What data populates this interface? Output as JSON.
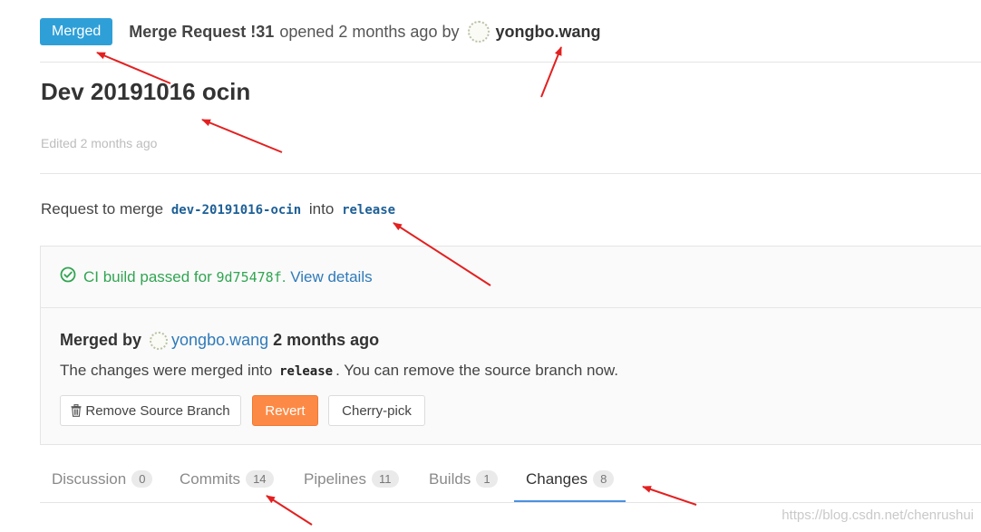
{
  "header": {
    "status_label": "Merged",
    "mr_id": "Merge Request !31",
    "opened_text": "opened 2 months ago by",
    "author": "yongbo.wang"
  },
  "title": "Dev 20191016 ocin",
  "edited": "Edited 2 months ago",
  "merge_request": {
    "prefix": "Request to merge",
    "source_branch": "dev-20191016-ocin",
    "into": "into",
    "target_branch": "release"
  },
  "ci": {
    "status_text": "CI build passed for",
    "sha": "9d75478f",
    "period": ".",
    "view_details": "View details"
  },
  "merged": {
    "label": "Merged by",
    "user": "yongbo.wang",
    "time": "2 months ago",
    "desc_before": "The changes were merged into",
    "branch": "release",
    "desc_after": ". You can remove the source branch now."
  },
  "buttons": {
    "remove_source_branch": "Remove Source Branch",
    "revert": "Revert",
    "cherry_pick": "Cherry-pick"
  },
  "tabs": [
    {
      "label": "Discussion",
      "count": "0"
    },
    {
      "label": "Commits",
      "count": "14"
    },
    {
      "label": "Pipelines",
      "count": "11"
    },
    {
      "label": "Builds",
      "count": "1"
    },
    {
      "label": "Changes",
      "count": "8"
    }
  ],
  "active_tab": "Changes",
  "watermark": "https://blog.csdn.net/chenrushui",
  "colors": {
    "merged_badge": "#2f9fd8",
    "ci_success": "#31a552",
    "link": "#2f7ab9",
    "revert_button": "#fc8a46",
    "active_tab_underline": "#4a90e2",
    "annotation_arrow": "#e32020"
  },
  "icons": {
    "ci_status": "check-circle-icon",
    "remove_branch": "trash-icon"
  }
}
